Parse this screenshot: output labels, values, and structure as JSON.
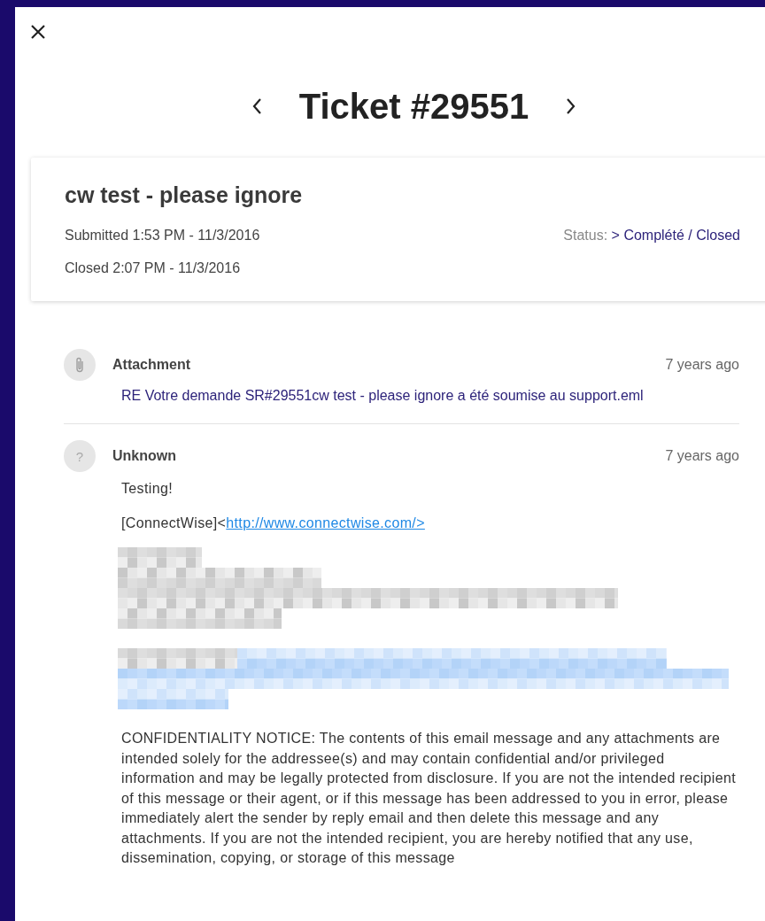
{
  "header": {
    "title": "Ticket #29551"
  },
  "ticket": {
    "title": "cw test - please ignore",
    "submitted": "Submitted 1:53 PM - 11/3/2016",
    "closed": "Closed 2:07 PM - 11/3/2016",
    "status_label": "Status:",
    "status_value": "> Complété / Closed"
  },
  "entries": [
    {
      "kind": "attachment",
      "author": "Attachment",
      "time": "7 years ago",
      "file": "RE Votre demande SR#29551cw test - please ignore a été soumise au support.eml"
    },
    {
      "kind": "unknown",
      "avatar": "?",
      "author": "Unknown",
      "time": "7 years ago",
      "body": [
        {
          "kind": "text",
          "text": "Testing!"
        },
        {
          "kind": "link_line",
          "prefix": "[ConnectWise]<",
          "link": "http://www.connectwise.com/>"
        },
        {
          "kind": "redacted_plain"
        },
        {
          "kind": "redacted_link"
        },
        {
          "kind": "text",
          "text": "CONFIDENTIALITY NOTICE: The contents of this email message and any attachments are intended solely for the addressee(s) and may contain confidential and/or privileged information and may be legally protected from disclosure. If you are not the intended recipient of this message or their agent, or if this message has been addressed to you in error, please immediately alert the sender by reply email and then delete this message and any attachments. If you are not the intended recipient, you are hereby notified that any use, dissemination, copying, or storage of this message"
        }
      ]
    }
  ]
}
